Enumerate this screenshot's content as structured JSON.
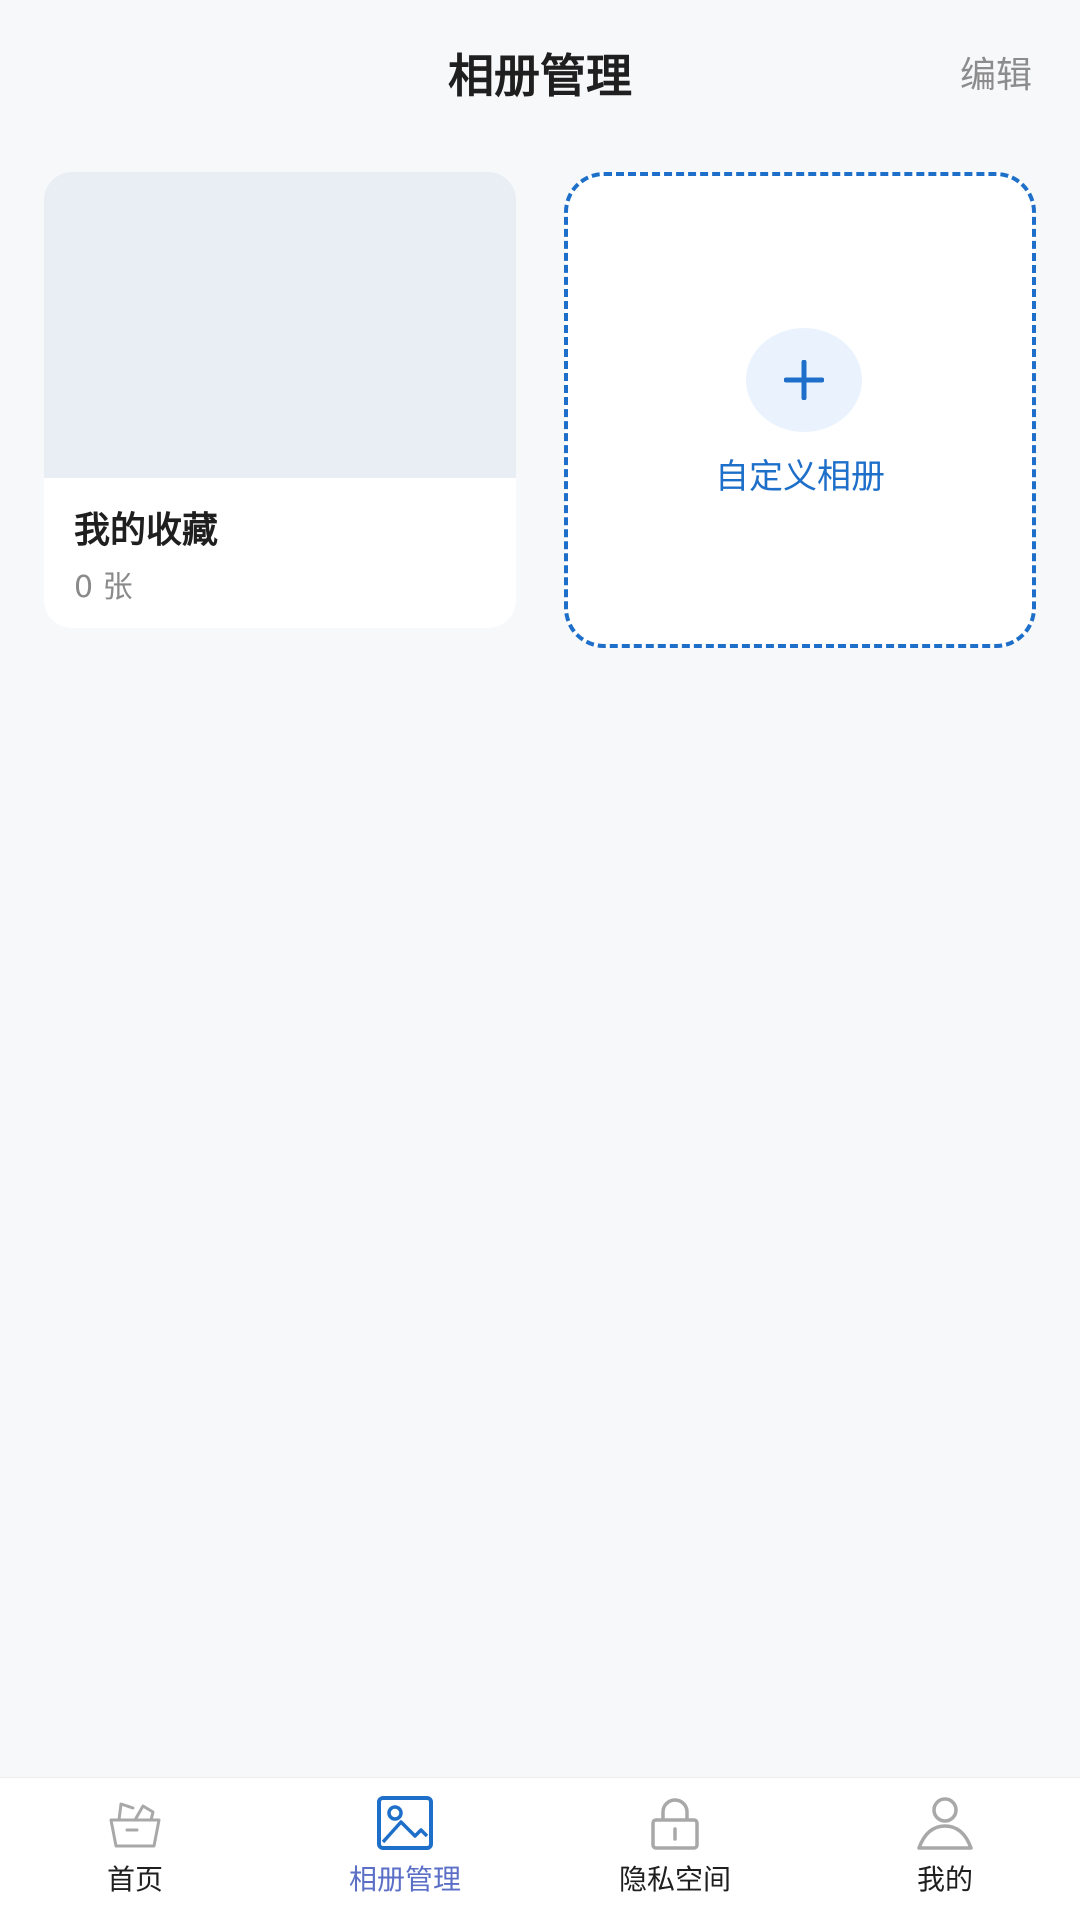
{
  "header": {
    "title": "相册管理",
    "edit_label": "编辑"
  },
  "albums": [
    {
      "name": "我的收藏",
      "count": "0 张"
    }
  ],
  "add_album": {
    "label": "自定义相册",
    "icon": "plus-icon"
  },
  "bottom_nav": {
    "items": [
      {
        "label": "首页",
        "icon": "basket-icon",
        "active": false
      },
      {
        "label": "相册管理",
        "icon": "image-icon",
        "active": true
      },
      {
        "label": "隐私空间",
        "icon": "lock-icon",
        "active": false
      },
      {
        "label": "我的",
        "icon": "user-icon",
        "active": false
      }
    ],
    "active_color": "#5b6fc7"
  },
  "colors": {
    "accent": "#1e6fc9",
    "background": "#f7f8fa",
    "cover_placeholder": "#e9eef4"
  }
}
